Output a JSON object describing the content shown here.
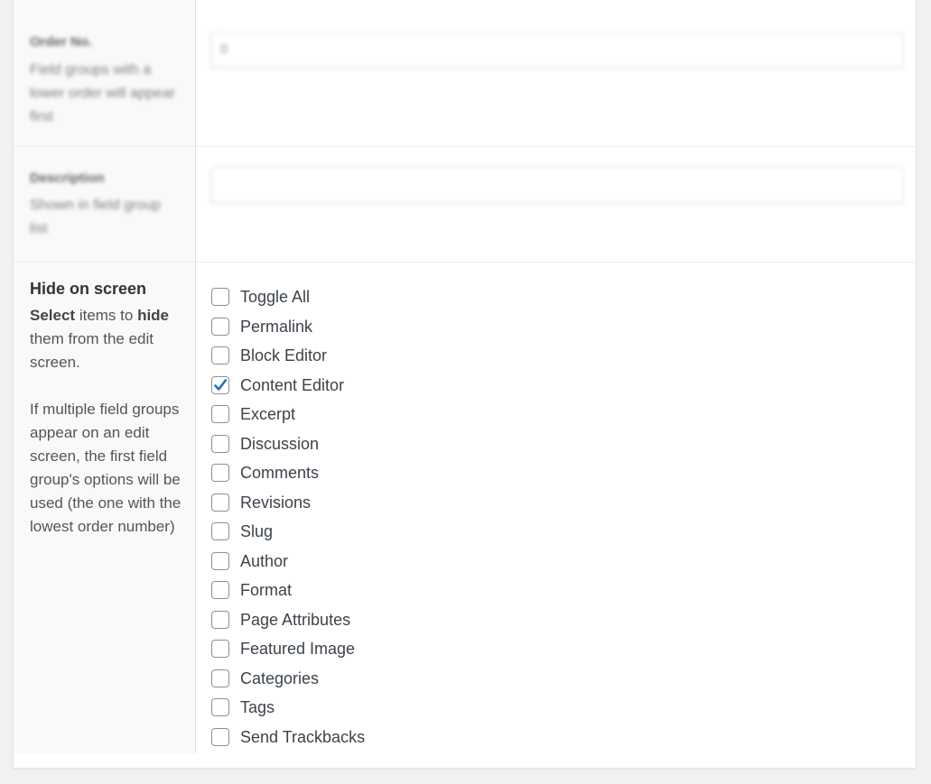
{
  "order_no": {
    "label": "Order No.",
    "description": "Field groups with a lower order will appear first",
    "value": "0"
  },
  "description_field": {
    "label": "Description",
    "description": "Shown in field group list",
    "value": ""
  },
  "hide_on_screen": {
    "label": "Hide on screen",
    "desc_select": "Select",
    "desc_items_to": " items to ",
    "desc_hide": "hide",
    "desc_rest": " them from the edit screen.",
    "desc_para2": "If multiple field groups appear on an edit screen, the first field group's options will be used (the one with the lowest order number)",
    "items": [
      {
        "label": "Toggle All",
        "checked": false
      },
      {
        "label": "Permalink",
        "checked": false
      },
      {
        "label": "Block Editor",
        "checked": false
      },
      {
        "label": "Content Editor",
        "checked": true
      },
      {
        "label": "Excerpt",
        "checked": false
      },
      {
        "label": "Discussion",
        "checked": false
      },
      {
        "label": "Comments",
        "checked": false
      },
      {
        "label": "Revisions",
        "checked": false
      },
      {
        "label": "Slug",
        "checked": false
      },
      {
        "label": "Author",
        "checked": false
      },
      {
        "label": "Format",
        "checked": false
      },
      {
        "label": "Page Attributes",
        "checked": false
      },
      {
        "label": "Featured Image",
        "checked": false
      },
      {
        "label": "Categories",
        "checked": false
      },
      {
        "label": "Tags",
        "checked": false
      },
      {
        "label": "Send Trackbacks",
        "checked": false
      }
    ]
  },
  "colors": {
    "checkmark": "#2271b1",
    "checkbox_border": "#8c8f94"
  }
}
